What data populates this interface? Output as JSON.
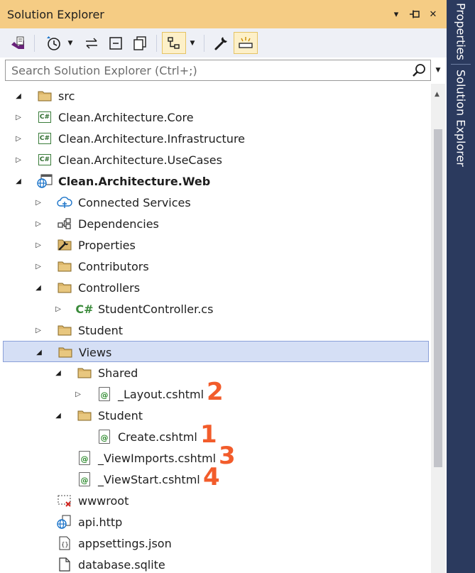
{
  "window": {
    "title": "Solution Explorer"
  },
  "title_controls": {
    "menu_glyph": "▾",
    "pin_glyph": "⊸",
    "close_glyph": "✕"
  },
  "search": {
    "placeholder": "Search Solution Explorer (Ctrl+;)",
    "value": ""
  },
  "side_tabs": [
    "Properties",
    "Solution Explorer"
  ],
  "tree": [
    {
      "label": "src",
      "icon": "folder-icon",
      "expander": "expanded",
      "bold": false
    },
    {
      "label": "Clean.Architecture.Core",
      "icon": "csharp-project-icon",
      "expander": "collapsed",
      "bold": false
    },
    {
      "label": "Clean.Architecture.Infrastructure",
      "icon": "csharp-project-icon",
      "expander": "collapsed",
      "bold": false
    },
    {
      "label": "Clean.Architecture.UseCases",
      "icon": "csharp-project-icon",
      "expander": "collapsed",
      "bold": false
    },
    {
      "label": "Clean.Architecture.Web",
      "icon": "web-project-icon",
      "expander": "expanded",
      "bold": true
    },
    {
      "label": "Connected Services",
      "icon": "connected-services-icon",
      "expander": "collapsed",
      "bold": false
    },
    {
      "label": "Dependencies",
      "icon": "dependencies-icon",
      "expander": "collapsed",
      "bold": false
    },
    {
      "label": "Properties",
      "icon": "properties-icon",
      "expander": "collapsed",
      "bold": false
    },
    {
      "label": "Contributors",
      "icon": "folder-icon",
      "expander": "collapsed",
      "bold": false
    },
    {
      "label": "Controllers",
      "icon": "folder-icon",
      "expander": "expanded",
      "bold": false
    },
    {
      "label": "StudentController.cs",
      "icon": "csharp-file-icon",
      "expander": "collapsed",
      "bold": false
    },
    {
      "label": "Student",
      "icon": "folder-icon",
      "expander": "collapsed",
      "bold": false
    },
    {
      "label": "Views",
      "icon": "folder-icon",
      "expander": "expanded",
      "bold": false,
      "selected": true
    },
    {
      "label": "Shared",
      "icon": "folder-icon",
      "expander": "expanded",
      "bold": false
    },
    {
      "label": "_Layout.cshtml",
      "icon": "razor-file-icon",
      "expander": "collapsed",
      "bold": false,
      "annotation": "2"
    },
    {
      "label": "Student",
      "icon": "folder-icon",
      "expander": "expanded",
      "bold": false
    },
    {
      "label": "Create.cshtml",
      "icon": "razor-file-icon",
      "expander": "none",
      "bold": false,
      "annotation": "1"
    },
    {
      "label": "_ViewImports.cshtml",
      "icon": "razor-file-icon",
      "expander": "none",
      "bold": false,
      "annotation": "3"
    },
    {
      "label": "_ViewStart.cshtml",
      "icon": "razor-file-icon",
      "expander": "none",
      "bold": false,
      "annotation": "4"
    },
    {
      "label": "wwwroot",
      "icon": "wwwroot-icon",
      "expander": "none",
      "bold": false
    },
    {
      "label": "api.http",
      "icon": "http-file-icon",
      "expander": "none",
      "bold": false
    },
    {
      "label": "appsettings.json",
      "icon": "json-file-icon",
      "expander": "none",
      "bold": false
    },
    {
      "label": "database.sqlite",
      "icon": "file-icon",
      "expander": "none",
      "bold": false
    }
  ],
  "colors": {
    "title_bar": "#f5cc84",
    "toolbar": "#eef0f6",
    "side_tabs": "#2b3a5e",
    "selection": "#d5dff5",
    "annotation": "#f25c2b"
  }
}
